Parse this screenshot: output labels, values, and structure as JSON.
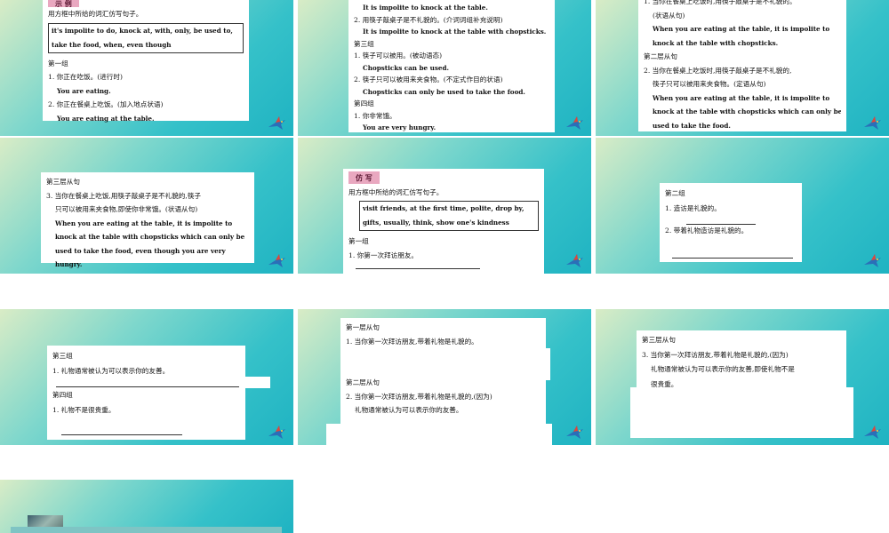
{
  "s1": {
    "tag": "示 例",
    "instr": "用方框中所给的词汇仿写句子。",
    "box1": "it's impolite to do, knock at, with, only, be used to,",
    "box2": "take the food, when, even though",
    "g1": "第一组",
    "q1": "1. 你正在吃饭。(进行时)",
    "a1": "You are eating.",
    "q2": "2. 你正在餐桌上吃饭。(加入地点状语)",
    "a2": "You are eating at the table."
  },
  "s2": {
    "a1": "It is impolite to knock at the table.",
    "q2": "2. 用筷子敲桌子是不礼貌的。(介词词组补充说明)",
    "a2": "It is impolite to knock at the table with chopsticks.",
    "g3": "第三组",
    "q3": "1. 筷子可以被用。(被动语态)",
    "a3": "Chopsticks can be used.",
    "q4": "2. 筷子只可以被用来夹食物。(不定式作目的状语)",
    "a4": "Chopsticks can only be used to take the food.",
    "g4": "第四组",
    "q5": "1. 你非常饿。",
    "a5": "You are very hungry."
  },
  "s3": {
    "q1": "1. 当你在餐桌上吃饭时,用筷子敲桌子是不礼貌的。",
    "q1b": "(状语从句)",
    "a1a": "When you are eating at the table, it is impolite to",
    "a1b": "knock at the table with chopsticks.",
    "l2": "第二层从句",
    "q2": "2. 当你在餐桌上吃饭时,用筷子敲桌子是不礼貌的,",
    "q2b": "筷子只可以被用来夹食物。(定语从句)",
    "a2a": "When you are eating at the table, it is impolite to",
    "a2b": "knock at the table with chopsticks which can only be",
    "a2c": "used to take the food."
  },
  "s4": {
    "l3": "第三层从句",
    "q3": "3. 当你在餐桌上吃饭,用筷子敲桌子是不礼貌的,筷子",
    "q3b": "只可以被用来夹食物,即使你非常饿。(状语从句)",
    "a3a": "When you are eating at the table, it is impolite to",
    "a3b": "knock at the table with chopsticks which can only be",
    "a3c": "used to take the food, even though you are very",
    "a3d": "hungry."
  },
  "s5": {
    "tag": "仿 写",
    "instr": "用方框中所给的词汇仿写句子。",
    "box1": "visit friends, at the first time, polite, drop by,",
    "box2": "gifts, usually, think, show one's kindness",
    "g1": "第一组",
    "q1": "1. 你第一次拜访朋友。"
  },
  "s6": {
    "g2": "第二组",
    "q1": "1. 造访是礼貌的。",
    "q2": "2. 带着礼物造访是礼貌的。"
  },
  "s7": {
    "g3": "第三组",
    "q1": "1. 礼物通常被认为可以表示你的友善。",
    "g4": "第四组",
    "q2": "1. 礼物不是很贵重。"
  },
  "s8": {
    "l1": "第一层从句",
    "q1": "1. 当你第一次拜访朋友,带着礼物是礼貌的。",
    "l2": "第二层从句",
    "q2": "2. 当你第一次拜访朋友,带着礼物是礼貌的,(因为)",
    "q2b": "礼物通常被认为可以表示你的友善。"
  },
  "s9": {
    "l3": "第三层从句",
    "q3": "3. 当你第一次拜访朋友,带着礼物是礼貌的,(因为)",
    "q3b": "礼物通常被认为可以表示你的友善,即使礼物不是",
    "q3c": "很贵重。"
  }
}
